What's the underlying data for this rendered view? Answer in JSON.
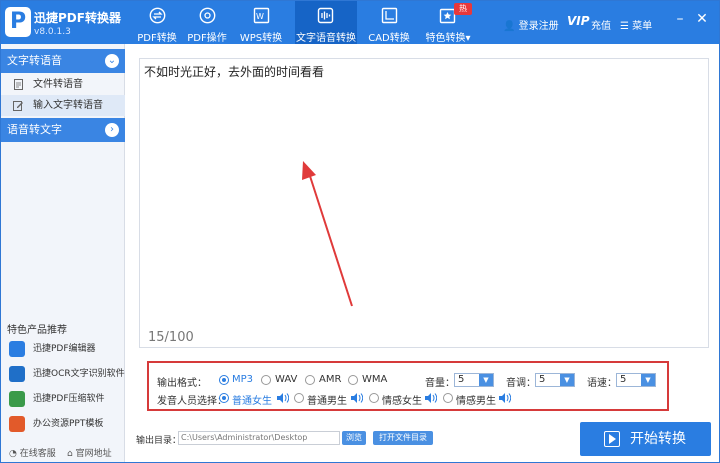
{
  "app": {
    "title": "迅捷PDF转换器",
    "version": "v8.0.1.3",
    "logo_letter": "P"
  },
  "nav": [
    {
      "label": "PDF转换",
      "icon": "pdf-convert-icon"
    },
    {
      "label": "PDF操作",
      "icon": "pdf-operation-icon"
    },
    {
      "label": "WPS转换",
      "icon": "wps-convert-icon"
    },
    {
      "label": "文字语音转换",
      "icon": "voice-icon",
      "active": true
    },
    {
      "label": "CAD转换",
      "icon": "cad-convert-icon"
    },
    {
      "label": "特色转换",
      "icon": "special-convert-icon"
    }
  ],
  "hot_badge": "热",
  "header": {
    "login": "登录注册",
    "vip": "VIP",
    "vip_sub": "充值",
    "menu": "菜单"
  },
  "sidebar": {
    "section1": "文字转语音",
    "section1_items": [
      {
        "label": "文件转语音"
      },
      {
        "label": "输入文字转语音",
        "active": true
      }
    ],
    "section2": "语音转文字",
    "featured_title": "特色产品推荐",
    "featured": [
      {
        "label": "迅捷PDF编辑器",
        "color": "#2a7de1"
      },
      {
        "label": "迅捷OCR文字识别软件",
        "color": "#1f6fc8"
      },
      {
        "label": "迅捷PDF压缩软件",
        "color": "#3a9a4a"
      },
      {
        "label": "办公资源PPT模板",
        "color": "#e25a2a"
      }
    ],
    "footer_service": "在线客服",
    "footer_site": "官网地址"
  },
  "editor": {
    "text": "不如时光正好，去外面的时间看看",
    "counter": "15/100"
  },
  "options": {
    "format_label": "输出格式：",
    "formats": [
      {
        "label": "MP3",
        "selected": true
      },
      {
        "label": "WAV",
        "selected": false
      },
      {
        "label": "AMR",
        "selected": false
      },
      {
        "label": "WMA",
        "selected": false
      }
    ],
    "volume_label": "音量：",
    "volume": "5",
    "pitch_label": "音调：",
    "pitch": "5",
    "speed_label": "语速：",
    "speed": "5",
    "voice_label": "发音人员选择：",
    "voices": [
      {
        "label": "普通女生",
        "selected": true
      },
      {
        "label": "普通男生",
        "selected": false
      },
      {
        "label": "情感女生",
        "selected": false
      },
      {
        "label": "情感男生",
        "selected": false
      }
    ]
  },
  "output": {
    "label": "输出目录：",
    "path": "C:\\Users\\Administrator\\Desktop",
    "browse": "浏览",
    "open_dir": "打开文件目录",
    "start": "开始转换"
  },
  "colors": {
    "primary": "#2a7de1",
    "highlight": "#d63a3a",
    "arrow": "#e03a3a"
  }
}
